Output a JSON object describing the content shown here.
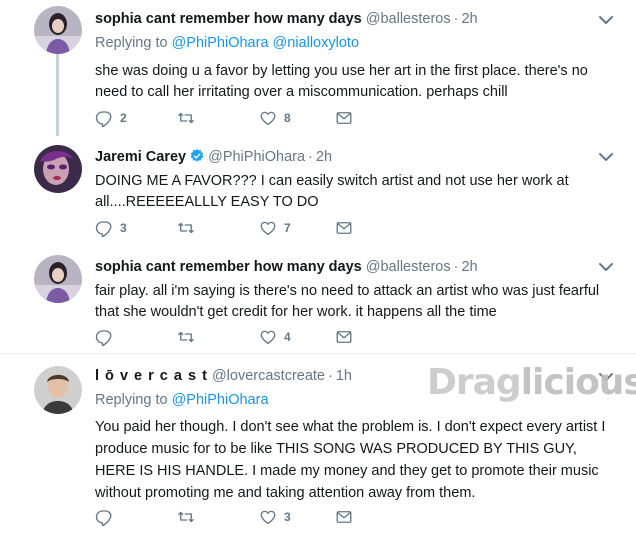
{
  "tweets": [
    {
      "name": "sophia cant remember how many days",
      "handle": "@ballesteros",
      "time": "2h",
      "replying_label": "Replying to",
      "mentions": [
        "@PhiPhiOhara",
        "@nialloxyloto"
      ],
      "text": "she was doing u a favor by letting you use her art in the first place. there's no need to call her irritating over a miscommunication. perhaps chill",
      "reply_count": "2",
      "retweet_count": "",
      "like_count": "8"
    },
    {
      "name": "Jaremi Carey",
      "handle": "@PhiPhiOhara",
      "time": "2h",
      "verified": true,
      "text": "DOING ME A FAVOR??? I can easily switch artist and not use her work at all....REEEEEALLLY EASY TO DO",
      "reply_count": "3",
      "retweet_count": "",
      "like_count": "7"
    },
    {
      "name": "sophia cant remember how many days",
      "handle": "@ballesteros",
      "time": "2h",
      "text": "fair play. all i'm saying is there's no need to attack an artist who was just fearful that she wouldn't get credit for her work. it happens all the time",
      "reply_count": "",
      "retweet_count": "",
      "like_count": "4"
    },
    {
      "name": "l ō v e r c a s t",
      "handle": "@lovercastcreate",
      "time": "1h",
      "replying_label": "Replying to",
      "mentions": [
        "@PhiPhiOhara"
      ],
      "text": "You paid her though. I don't see what the problem is. I don't expect every artist I produce music for to be like THIS SONG WAS PRODUCED BY THIS GUY, HERE IS HIS HANDLE. I made my money and they get to promote their music without promoting me and taking attention away from them.",
      "reply_count": "",
      "retweet_count": "",
      "like_count": "3"
    }
  ],
  "separator": "·",
  "watermark": {
    "part1": "Drag",
    "part2": "licious"
  },
  "colors": {
    "link": "#1b95e0",
    "muted": "#657786",
    "thread_line": "#c4cfd6",
    "verified": "#1da1f2"
  },
  "icons": [
    "reply-icon",
    "retweet-icon",
    "like-icon",
    "dm-icon",
    "chevron-down-icon",
    "verified-icon"
  ]
}
